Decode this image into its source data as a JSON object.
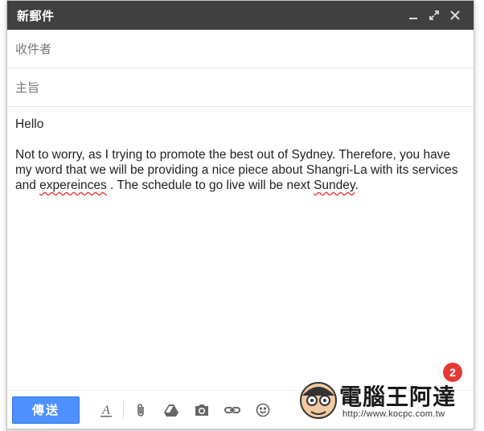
{
  "window": {
    "title": "新郵件"
  },
  "fields": {
    "recipients_placeholder": "收件者",
    "subject_placeholder": "主旨"
  },
  "body": {
    "greeting": "Hello",
    "p1_a": "Not to worry, as I trying to promote the best out of Sydney.  Therefore, you have my word that we will be providing a nice piece about Shangri-La with its services and ",
    "p1_spell1": "expereinces",
    "p1_b": " .  The schedule to go live will be next ",
    "p1_spell2": "Sundey",
    "p1_c": "."
  },
  "toolbar": {
    "send_label": "傳送"
  },
  "badge": {
    "count": "2"
  },
  "watermark": {
    "brand": "電腦王阿達",
    "url": "http://www.kocpc.com.tw"
  },
  "colors": {
    "titlebar": "#404040",
    "send_button": "#4d90fe",
    "spell_underline": "#e64a4a",
    "badge": "#e53935"
  },
  "icons": [
    "minimize-icon",
    "expand-icon",
    "close-icon",
    "formatting-icon",
    "attach-icon",
    "drive-icon",
    "photo-icon",
    "link-icon",
    "emoji-icon"
  ]
}
